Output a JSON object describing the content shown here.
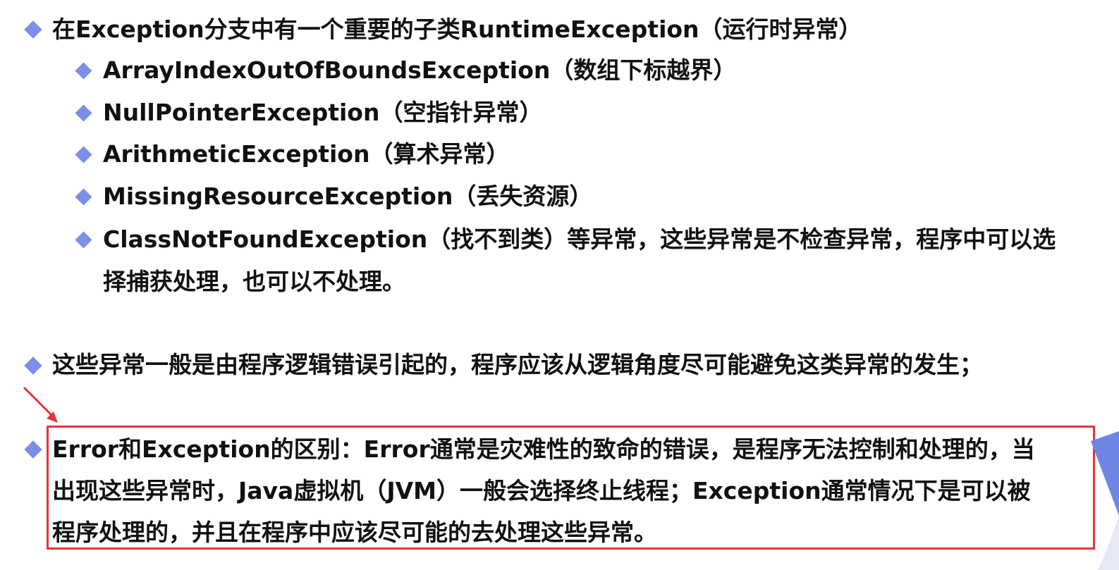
{
  "section1": {
    "heading": "在Exception分支中有一个重要的子类RuntimeException（运行时异常）",
    "items": [
      "ArrayIndexOutOfBoundsException（数组下标越界）",
      "NullPointerException（空指针异常）",
      "ArithmeticException（算术异常）",
      "MissingResourceException（丢失资源）",
      "ClassNotFoundException（找不到类）等异常，这些异常是不检查异常，程序中可以选"
    ],
    "item5_line2": "择捕获处理，也可以不处理。"
  },
  "section2": {
    "text": "这些异常一般是由程序逻辑错误引起的，程序应该从逻辑角度尽可能避免这类异常的发生；"
  },
  "section3": {
    "line1": "Error和Exception的区别：Error通常是灾难性的致命的错误，是程序无法控制和处理的，当",
    "line2": "出现这些异常时，Java虚拟机（JVM）一般会选择终止线程；Exception通常情况下是可以被",
    "line3": "程序处理的，并且在程序中应该尽可能的去处理这些异常。"
  },
  "colors": {
    "bullet": "#7b8fe8",
    "highlight_border": "#e8333a",
    "arrow": "#e8333a",
    "corner_shape": "#6f86e6"
  }
}
